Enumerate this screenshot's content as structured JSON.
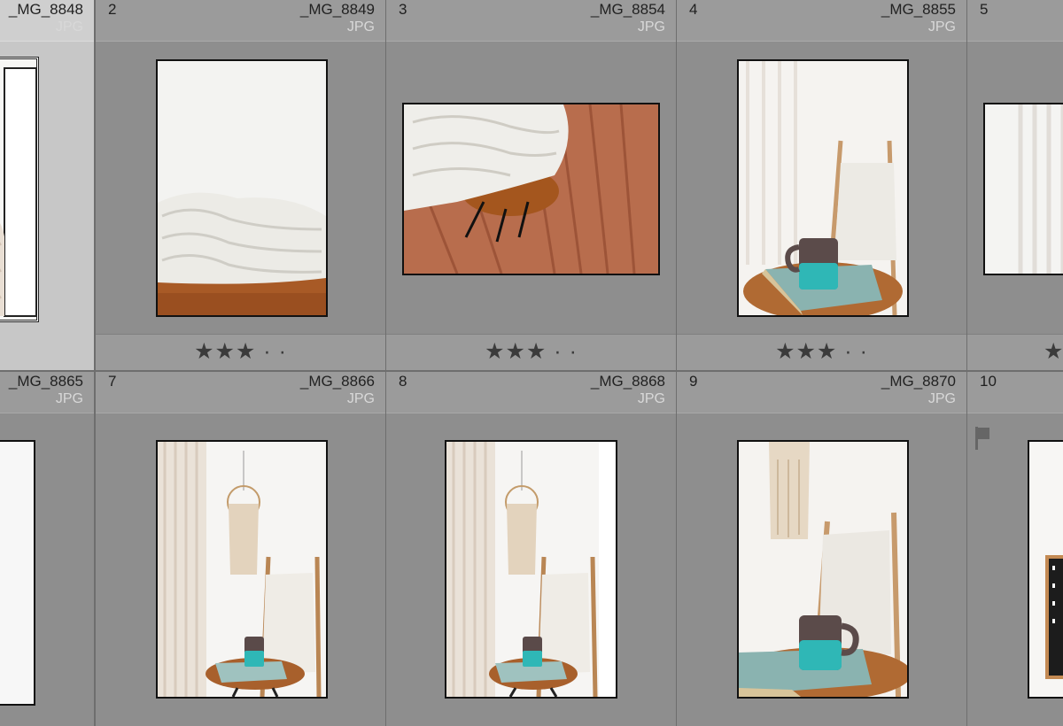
{
  "cells": [
    {
      "id": "c1",
      "index": "",
      "filename": "_MG_8848",
      "filetype": "JPG",
      "rating": "",
      "selected": true
    },
    {
      "id": "c2",
      "index": "2",
      "filename": "_MG_8849",
      "filetype": "JPG",
      "rating": "★★★ · ·"
    },
    {
      "id": "c3",
      "index": "3",
      "filename": "_MG_8854",
      "filetype": "JPG",
      "rating": "★★★ · ·"
    },
    {
      "id": "c4",
      "index": "4",
      "filename": "_MG_8855",
      "filetype": "JPG",
      "rating": "★★★ · ·"
    },
    {
      "id": "c5",
      "index": "5",
      "filename": "",
      "filetype": "",
      "rating": "★"
    },
    {
      "id": "c6",
      "index": "",
      "filename": "_MG_8865",
      "filetype": "JPG",
      "rating": ""
    },
    {
      "id": "c7",
      "index": "7",
      "filename": "_MG_8866",
      "filetype": "JPG",
      "rating": ""
    },
    {
      "id": "c8",
      "index": "8",
      "filename": "_MG_8868",
      "filetype": "JPG",
      "rating": ""
    },
    {
      "id": "c9",
      "index": "9",
      "filename": "_MG_8870",
      "filetype": "JPG",
      "rating": ""
    },
    {
      "id": "c10",
      "index": "10",
      "filename": "",
      "filetype": "",
      "rating": "",
      "flagged": true
    }
  ],
  "thumbnails": {
    "c1": "knit-sweater-closeup",
    "c2": "knit-blanket-on-stool",
    "c3": "knit-blanket-wood-floor",
    "c4": "mug-on-stool-with-ladder",
    "c5": "curtain",
    "c6": "white-wall",
    "c7": "room-with-macrame-and-mug",
    "c8": "room-with-macrame-and-mug",
    "c9": "mug-closeup-with-macrame",
    "c10": "letter-board"
  },
  "colors": {
    "grid_bg": "#8e8e8e",
    "selected_bg": "#c7c7c7",
    "header_bg": "#9b9b9b",
    "star": "#3b3b3b",
    "turquoise": "#2fb7b6",
    "wood": "#b0642e"
  }
}
